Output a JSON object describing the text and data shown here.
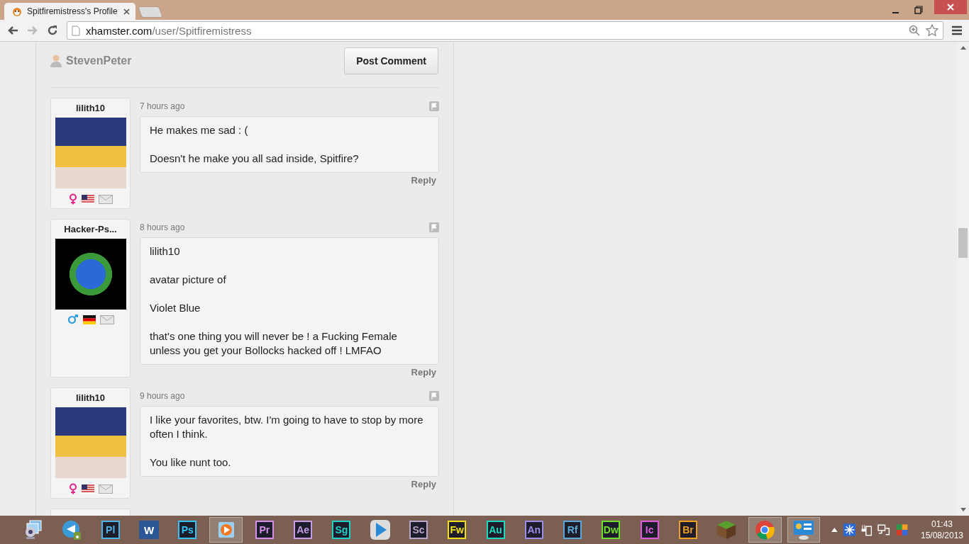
{
  "window": {
    "tab_title": "Spitfiremistress's Profile"
  },
  "address_bar": {
    "domain": "xhamster.com",
    "path": "/user/Spitfiremistress"
  },
  "comment_form": {
    "user": "StevenPeter",
    "button": "Post Comment"
  },
  "comments": [
    {
      "user": "lilith10",
      "badges": [
        {
          "kind": "female"
        },
        {
          "kind": "us-flag"
        },
        {
          "kind": "mail"
        }
      ],
      "time": "7 hours ago",
      "paragraphs": [
        "He makes me sad : (",
        "Doesn't he make you all sad inside, Spitfire?"
      ],
      "reply": "Reply"
    },
    {
      "user": "Hacker-Ps...",
      "badges": [
        {
          "kind": "male"
        },
        {
          "kind": "de-flag"
        },
        {
          "kind": "mail"
        }
      ],
      "time": "8 hours ago",
      "paragraphs": [
        "lilith10",
        "avatar picture of",
        "Violet Blue",
        "that's one thing you will never be ! a Fucking Female unless you get your Bollocks hacked off ! LMFAO"
      ],
      "reply": "Reply"
    },
    {
      "user": "lilith10",
      "badges": [
        {
          "kind": "female"
        },
        {
          "kind": "us-flag"
        },
        {
          "kind": "mail"
        }
      ],
      "time": "9 hours ago",
      "paragraphs": [
        "I like your favorites, btw. I'm going to have to stop by more often I think.",
        "You like nunt too."
      ],
      "reply": "Reply"
    }
  ],
  "taskbar": {
    "apps": [
      {
        "kind": "photo",
        "selected": false
      },
      {
        "kind": "sync",
        "selected": false
      },
      {
        "kind": "adobe",
        "label": "Pl",
        "color": "#4fb3e6",
        "selected": false
      },
      {
        "kind": "word",
        "label": "W",
        "selected": false
      },
      {
        "kind": "adobe",
        "label": "Ps",
        "color": "#31c5f4",
        "selected": false
      },
      {
        "kind": "media",
        "selected": true
      },
      {
        "kind": "adobe",
        "label": "Pr",
        "color": "#d58dea",
        "selected": false
      },
      {
        "kind": "adobe",
        "label": "Ae",
        "color": "#c49ce8",
        "selected": false
      },
      {
        "kind": "adobe",
        "label": "Sg",
        "color": "#1fd0c8",
        "selected": false
      },
      {
        "kind": "player",
        "selected": false
      },
      {
        "kind": "adobe",
        "label": "Sc",
        "color": "#b8a6c8",
        "selected": false
      },
      {
        "kind": "adobe",
        "label": "Fw",
        "color": "#f4e01a",
        "selected": false
      },
      {
        "kind": "adobe",
        "label": "Au",
        "color": "#1fd8c0",
        "selected": false
      },
      {
        "kind": "adobe",
        "label": "An",
        "color": "#9a8ce8",
        "selected": false
      },
      {
        "kind": "adobe",
        "label": "Rf",
        "color": "#5aa8d8",
        "selected": false
      },
      {
        "kind": "adobe",
        "label": "Dw",
        "color": "#6fe02a",
        "selected": false
      },
      {
        "kind": "adobe",
        "label": "Ic",
        "color": "#e05ae0",
        "selected": false
      },
      {
        "kind": "adobe",
        "label": "Br",
        "color": "#f0a020",
        "selected": false
      },
      {
        "kind": "block",
        "selected": false
      },
      {
        "kind": "chrome",
        "selected": true
      },
      {
        "kind": "panel",
        "selected": true
      }
    ],
    "time": "01:43",
    "date": "15/08/2013"
  }
}
